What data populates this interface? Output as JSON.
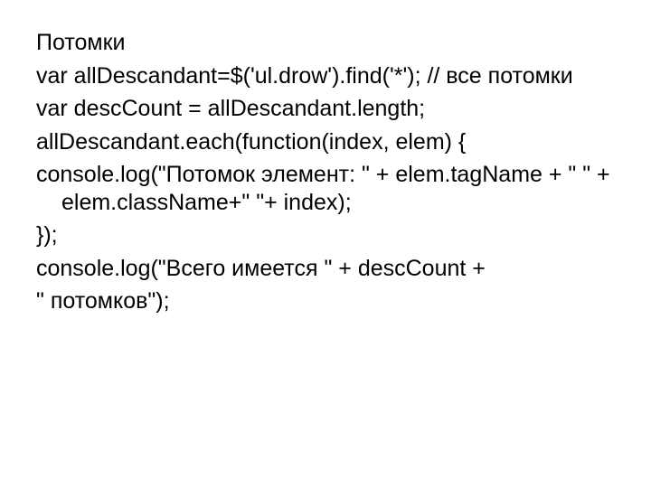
{
  "lines": [
    "Потомки",
    "var allDescandant=$('ul.drow').find('*'); // все потомки",
    "var descCount = allDescandant.length;",
    "allDescandant.each(function(index, elem) {",
    "console.log(\"Потомок элемент: \" + elem.tagName + \" \" + elem.className+\" \"+ index);",
    "});",
    "console.log(\"Всего имеется \" + descCount +",
    "\"  потомков\");"
  ]
}
